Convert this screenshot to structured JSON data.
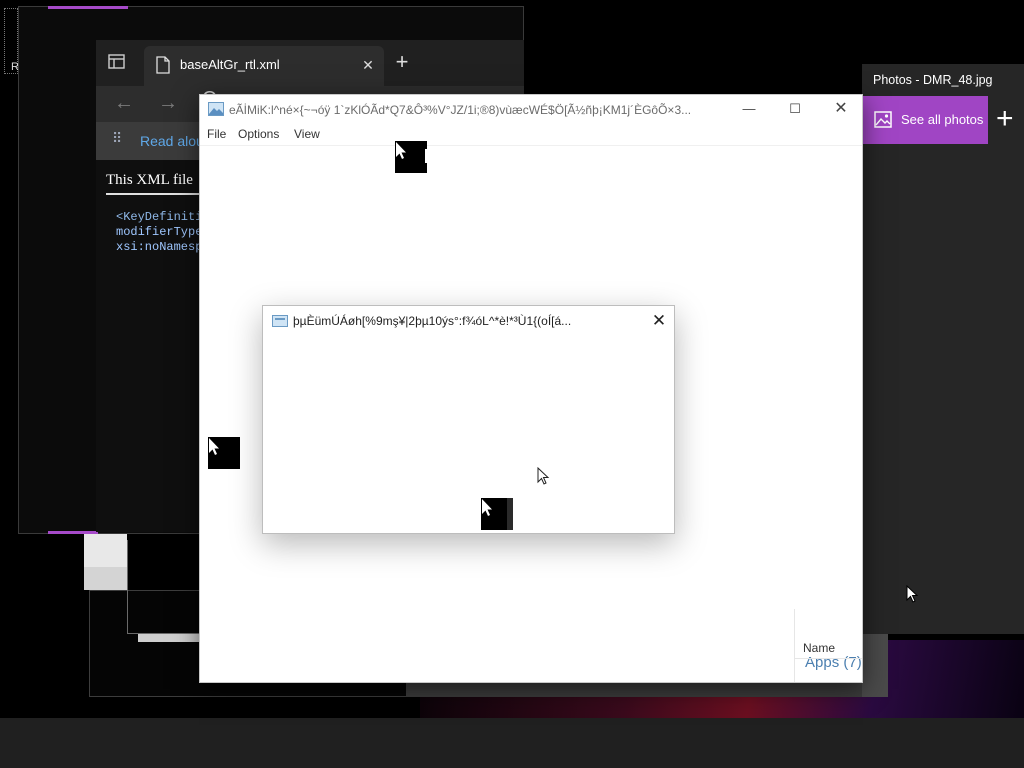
{
  "desktop": {
    "label": "R"
  },
  "browser": {
    "tab_title": "baseAltGr_rtl.xml",
    "tab_close": "✕",
    "new_tab": "+",
    "nav_back": "←",
    "nav_forward": "→",
    "nav_refresh": "C",
    "read_dots": "⠿",
    "read_aloud": "Read alou",
    "heading": "This XML file",
    "xml_lines": [
      "<KeyDefiniti",
      "modifierType",
      "xsi:noNamesp"
    ]
  },
  "photos": {
    "title": "Photos - DMR_48.jpg",
    "see_all": "See all photos",
    "add": "+"
  },
  "main_window": {
    "title": "eÃİMiK:l^n⁠é×{~¬óÿ 1`zKlÓÃd*Q7&Ô⁠³%⁠V°JZ/1i;®8)vùæcWÉ$Ö[Ã½ñþ⁠¡KM⁠1j´ÈGôÕ×3...",
    "minimize": "—",
    "maximize": "☐",
    "close": "✕",
    "menu": [
      "File",
      "Options",
      "View"
    ],
    "name_header": "Name",
    "apps_label": "Apps (7)"
  },
  "dialog": {
    "title": "þ⁠µÈüm⁠ÚÁøh[%⁠⁠⁠9m⁠ş¥|2þµ10⁠ýs°⁠:f¾⁠óL^*è!*³Ù1{(oÍ[á...",
    "close": "✕",
    "bottom_text": "⁠⁠ ⁠⁠ ⁠⁠ ⁠ ⁠⁠⁠⁠⁠⁠ ⁠⁠ ⁠⁠⁠ ⁠⁠⁠"
  },
  "colors": {
    "photos_accent": "#a045c4",
    "link_blue": "#5fa8e8",
    "desktop_bg": "#000000"
  },
  "icons": [
    "tab-actions-icon",
    "file-icon",
    "image-icon",
    "photo-icon",
    "mouse-pointer-icon"
  ]
}
